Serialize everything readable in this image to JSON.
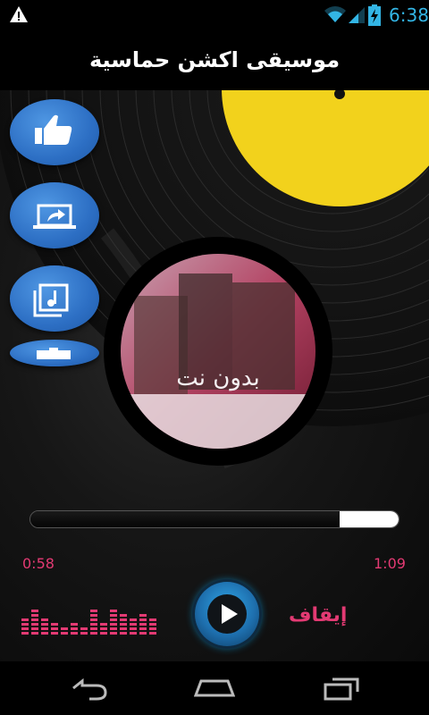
{
  "status_bar": {
    "time": "6:38",
    "icons": [
      "warning-icon",
      "wifi-icon",
      "signal-icon",
      "battery-charging-icon"
    ],
    "accent": "#33b5e5"
  },
  "app": {
    "title": "موسيقى اكشن حماسية"
  },
  "side_buttons": [
    {
      "name": "like-button",
      "icon": "thumbs-up-icon"
    },
    {
      "name": "share-button",
      "icon": "share-screen-icon"
    },
    {
      "name": "playlist-button",
      "icon": "music-library-icon"
    },
    {
      "name": "more-apps-button",
      "icon": "briefcase-icon"
    }
  ],
  "cover_art": {
    "text": "بدون نت"
  },
  "player": {
    "elapsed": "0:58",
    "duration": "1:09",
    "progress_fraction": 0.84,
    "stop_label": "إيقاف",
    "accent": "#e33a73"
  },
  "nav_bar": {
    "icons": [
      "back-icon",
      "home-icon",
      "recent-apps-icon"
    ]
  }
}
